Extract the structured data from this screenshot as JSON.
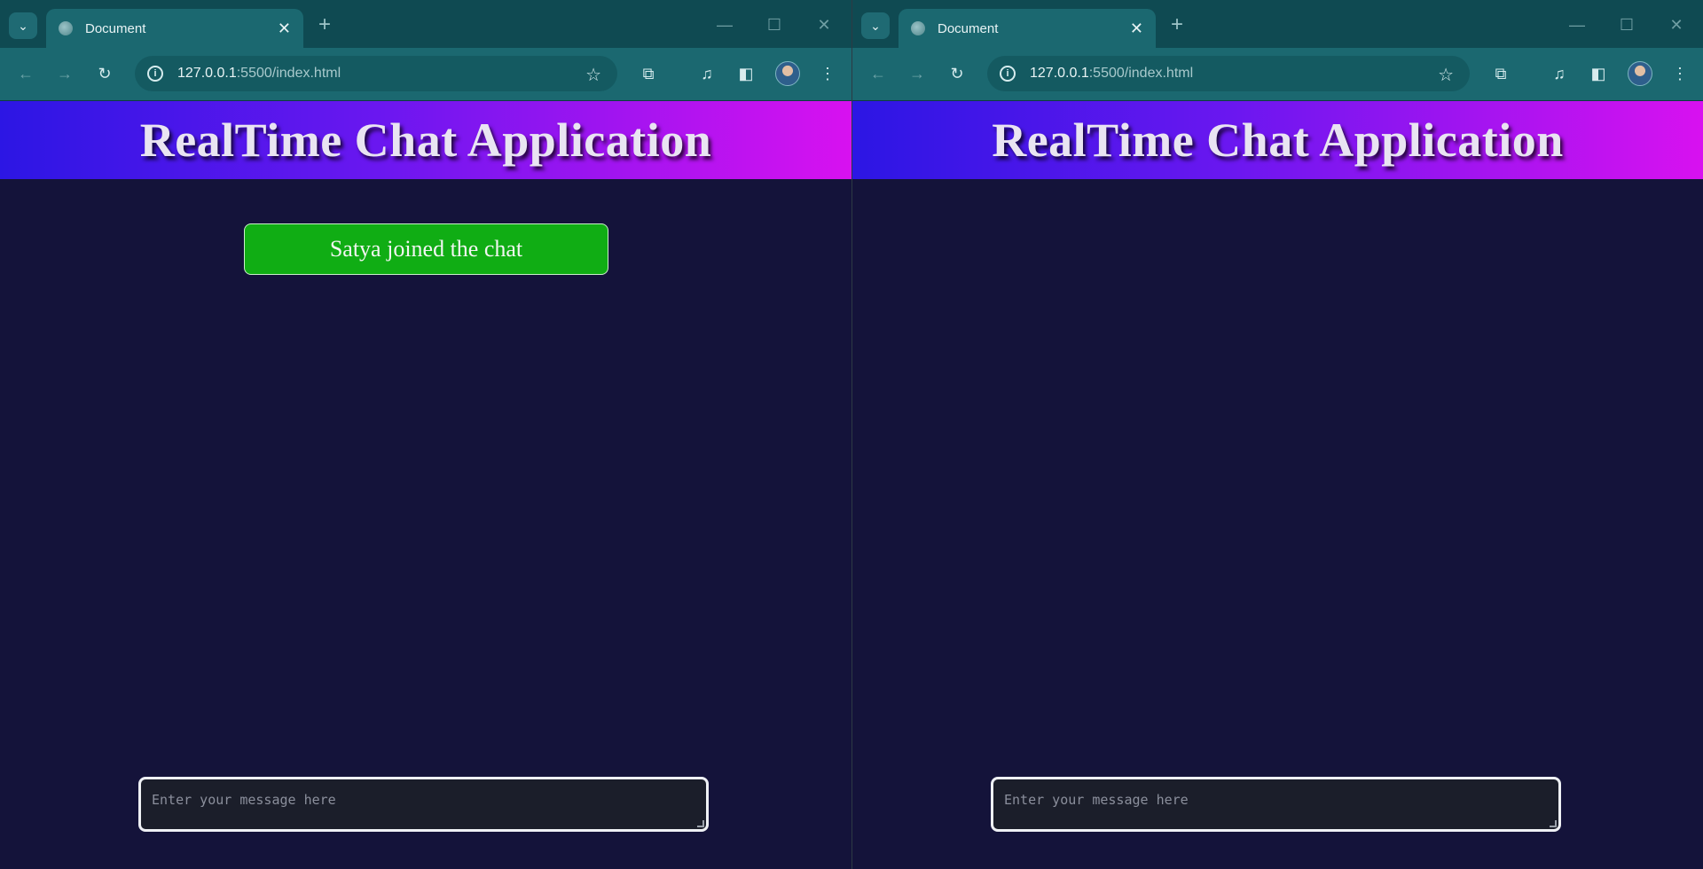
{
  "windows": [
    {
      "tab": {
        "title": "Document",
        "close": "✕"
      },
      "toolbar": {
        "url_host": "127.0.0.1",
        "url_path": ":5500/index.html"
      },
      "page": {
        "heading": "RealTime Chat Application",
        "notification": "Satya joined the chat",
        "message_placeholder": "Enter your message here"
      }
    },
    {
      "tab": {
        "title": "Document",
        "close": "✕"
      },
      "toolbar": {
        "url_host": "127.0.0.1",
        "url_path": ":5500/index.html"
      },
      "page": {
        "heading": "RealTime Chat Application",
        "message_placeholder": "Enter your message here"
      }
    }
  ],
  "icons": {
    "tab_search": "⌄",
    "new_tab": "+",
    "minimize": "—",
    "maximize": "☐",
    "window_close": "✕",
    "back": "←",
    "forward": "→",
    "reload": "↻",
    "info": "i",
    "star": "☆",
    "extensions": "⧉",
    "media": "♫",
    "side_panel": "◧",
    "menu": "⋮"
  },
  "colors": {
    "header_gradient_start": "#2c16e4",
    "header_gradient_end": "#d811f0",
    "notification_green": "#10ad14",
    "page_background": "#14133a",
    "browser_frame": "#1b6870"
  }
}
